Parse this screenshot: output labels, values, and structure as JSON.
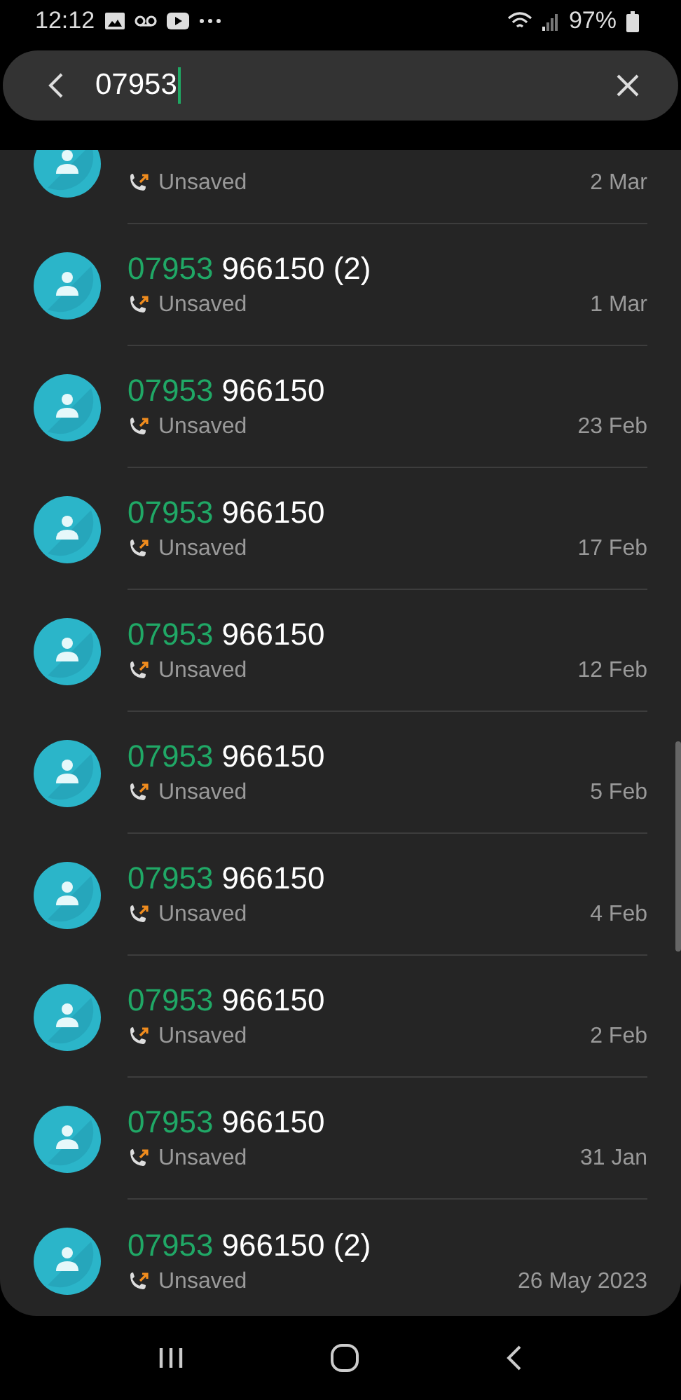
{
  "status_bar": {
    "time": "12:12",
    "battery": "97%"
  },
  "search": {
    "value": "07953"
  },
  "results": [
    {
      "status": "Unsaved",
      "date": "2 Mar"
    },
    {
      "match": "07953",
      "rest": " 966150 (2)",
      "status": "Unsaved",
      "date": "1 Mar"
    },
    {
      "match": "07953",
      "rest": " 966150",
      "status": "Unsaved",
      "date": "23 Feb"
    },
    {
      "match": "07953",
      "rest": " 966150",
      "status": "Unsaved",
      "date": "17 Feb"
    },
    {
      "match": "07953",
      "rest": " 966150",
      "status": "Unsaved",
      "date": "12 Feb"
    },
    {
      "match": "07953",
      "rest": " 966150",
      "status": "Unsaved",
      "date": "5 Feb"
    },
    {
      "match": "07953",
      "rest": " 966150",
      "status": "Unsaved",
      "date": "4 Feb"
    },
    {
      "match": "07953",
      "rest": " 966150",
      "status": "Unsaved",
      "date": "2 Feb"
    },
    {
      "match": "07953",
      "rest": " 966150",
      "status": "Unsaved",
      "date": "31 Jan"
    },
    {
      "match": "07953",
      "rest": " 966150 (2)",
      "status": "Unsaved",
      "date": "26 May 2023"
    }
  ]
}
